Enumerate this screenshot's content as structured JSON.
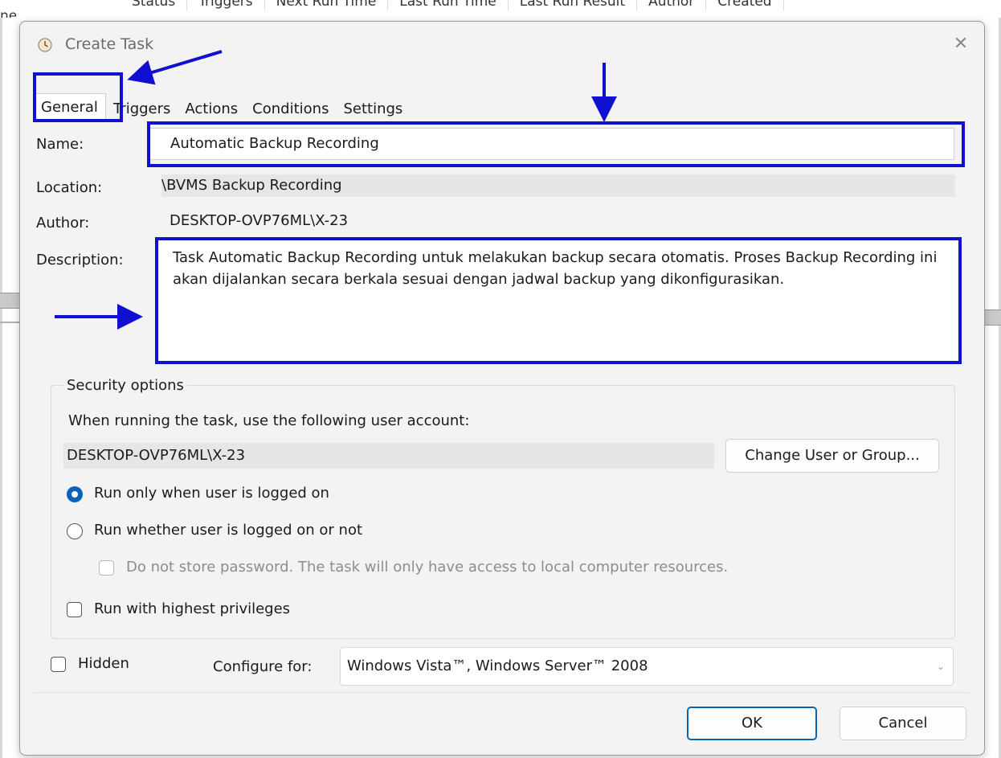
{
  "background": {
    "partial_text": "ne",
    "columns": [
      "Status",
      "Triggers",
      "Next Run Time",
      "Last Run Time",
      "Last Run Result",
      "Author",
      "Created"
    ]
  },
  "dialog": {
    "title": "Create Task",
    "close_icon": "close-icon",
    "tabs": [
      "General",
      "Triggers",
      "Actions",
      "Conditions",
      "Settings"
    ],
    "active_tab": "General"
  },
  "general": {
    "name_label": "Name:",
    "name_value": "Automatic Backup Recording",
    "location_label": "Location:",
    "location_value": "\\BVMS Backup Recording",
    "author_label": "Author:",
    "author_value": "DESKTOP-OVP76ML\\X-23",
    "description_label": "Description:",
    "description_value": "Task Automatic Backup Recording untuk melakukan backup secara otomatis. Proses Backup Recording ini akan dijalankan secara berkala sesuai dengan jadwal backup yang dikonfigurasikan."
  },
  "security": {
    "title": "Security options",
    "account_prompt": "When running the task, use the following user account:",
    "account_value": "DESKTOP-OVP76ML\\X-23",
    "change_button": "Change User or Group...",
    "radio_logged_on": "Run only when user is logged on",
    "radio_whether": "Run whether user is logged on or not",
    "no_store_password": "Do not store password.  The task will only have access to local computer resources.",
    "highest_privileges": "Run with highest privileges",
    "selected_option": "Run only when user is logged on"
  },
  "footer": {
    "hidden_label": "Hidden",
    "configure_label": "Configure for:",
    "configure_value": "Windows Vista™, Windows Server™ 2008",
    "ok_button": "OK",
    "cancel_button": "Cancel"
  },
  "colors": {
    "annotation": "#1010d0",
    "accent": "#0a63b6"
  }
}
